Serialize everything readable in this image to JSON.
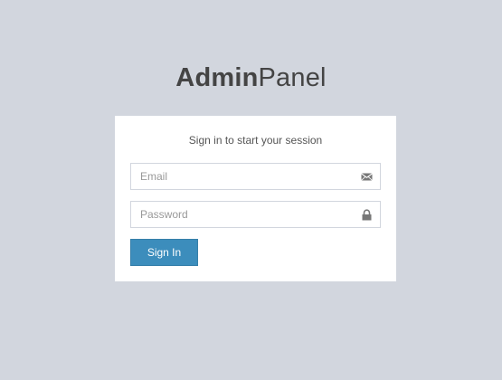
{
  "logo": {
    "bold": "Admin",
    "light": "Panel"
  },
  "login": {
    "message": "Sign in to start your session",
    "email_placeholder": "Email",
    "email_value": "",
    "password_placeholder": "Password",
    "password_value": "",
    "signin_label": "Sign In"
  },
  "icons": {
    "email": "envelope-icon",
    "password": "lock-icon"
  },
  "colors": {
    "background": "#d2d6de",
    "primary": "#3c8dbc",
    "box": "#ffffff",
    "text": "#444444"
  }
}
